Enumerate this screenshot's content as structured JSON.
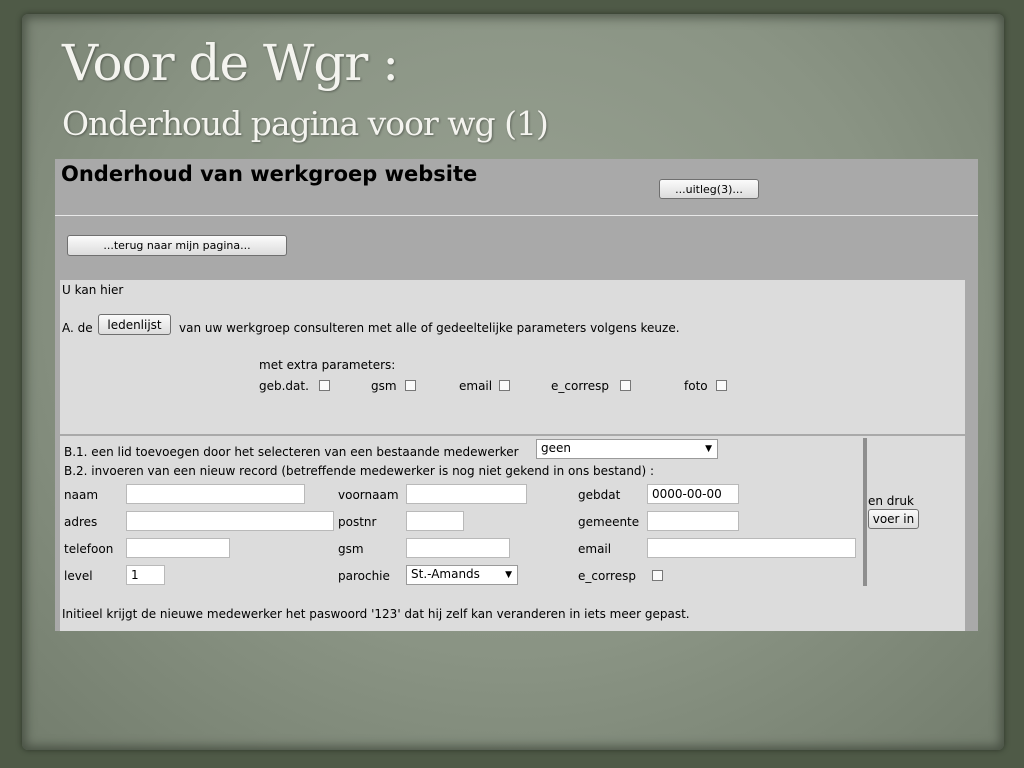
{
  "slide": {
    "title": "Voor de Wgr :",
    "subtitle": "Onderhoud pagina voor wg (1)"
  },
  "page": {
    "heading": "Onderhoud van werkgroep website",
    "uitleg_button": "...uitleg(3)...",
    "back_button": "...terug naar mijn pagina..."
  },
  "section_a": {
    "intro": "U kan hier",
    "prefix": "A. de",
    "ledenlijst_button": "ledenlijst",
    "suffix": "van uw werkgroep consulteren met alle of gedeeltelijke parameters volgens keuze.",
    "extra_label": "met extra parameters:",
    "params": [
      "geb.dat.",
      "gsm",
      "email",
      "e_corresp",
      "foto"
    ]
  },
  "section_b": {
    "b1_text": "B.1. een lid toevoegen door het selecteren van een bestaande medewerker",
    "b1_select": "geen",
    "b2_text": "B.2. invoeren van een nieuw record (betreffende medewerker is nog niet gekend in ons bestand) :",
    "fields": {
      "naam": {
        "label": "naam",
        "value": ""
      },
      "voornaam": {
        "label": "voornaam",
        "value": ""
      },
      "gebdat": {
        "label": "gebdat",
        "value": "0000-00-00"
      },
      "adres": {
        "label": "adres",
        "value": ""
      },
      "postnr": {
        "label": "postnr",
        "value": ""
      },
      "gemeente": {
        "label": "gemeente",
        "value": ""
      },
      "telefoon": {
        "label": "telefoon",
        "value": ""
      },
      "gsm": {
        "label": "gsm",
        "value": ""
      },
      "email": {
        "label": "email",
        "value": ""
      },
      "level": {
        "label": "level",
        "value": "1"
      },
      "parochie": {
        "label": "parochie",
        "value": "St.-Amands"
      },
      "e_corresp": {
        "label": "e_corresp"
      }
    },
    "en_druk": "en druk",
    "voer_in_button": "voer in",
    "note": "Initieel krijgt de nieuwe medewerker het paswoord '123' dat hij zelf kan veranderen in iets meer gepast."
  },
  "icons": {
    "dropdown": "chevron-down-icon"
  }
}
